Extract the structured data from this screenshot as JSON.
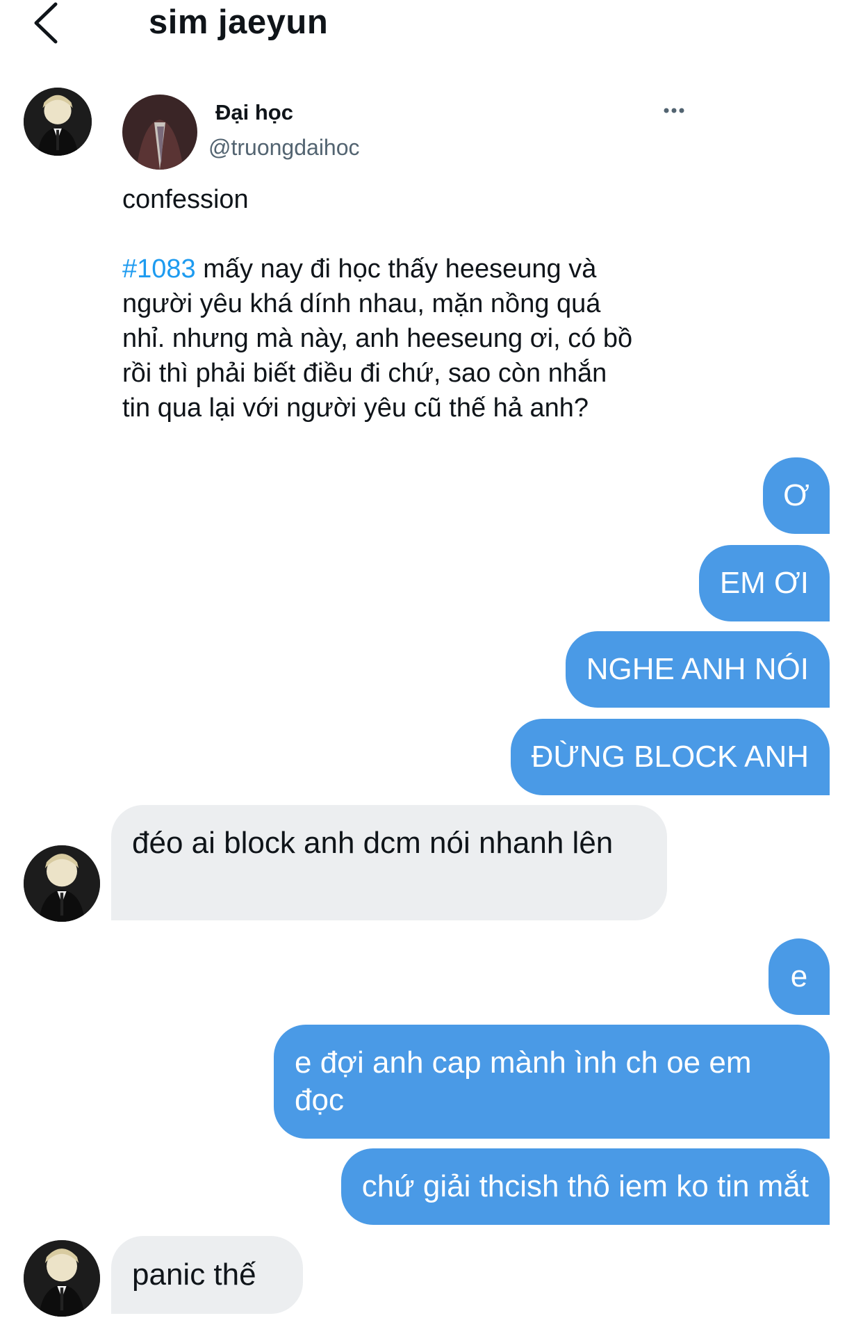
{
  "header": {
    "title": "sim jaeyun",
    "back_icon": "chevron-left-icon"
  },
  "card": {
    "name": "Đại học",
    "handle": "@truongdaihoc",
    "more_icon": "more-dots-icon",
    "label": "confession",
    "hashtag": "#1083",
    "lines": [
      " mấy nay đi học thấy heeseung và",
      "người yêu khá dính nhau, mặn nồng quá",
      "nhỉ. nhưng mà này, anh heeseung ơi, có bồ",
      "rồi thì phải biết điều đi chứ, sao còn nhắn",
      "tin qua lại với người yêu cũ thế hả anh?"
    ]
  },
  "messages": [
    {
      "dir": "sent",
      "text": "Ơ"
    },
    {
      "dir": "sent",
      "text": "EM ƠI"
    },
    {
      "dir": "sent",
      "text": "NGHE ANH NÓI"
    },
    {
      "dir": "sent",
      "text": "ĐỪNG BLOCK ANH"
    },
    {
      "dir": "received",
      "text": "đéo ai block anh dcm nói nhanh lên"
    },
    {
      "dir": "sent",
      "text": "e"
    },
    {
      "dir": "sent",
      "text": "e đợi anh cap mành ình ch oe em đọc"
    },
    {
      "dir": "sent",
      "text": "chứ giải thcish thô iem ko tin mắt"
    },
    {
      "dir": "received",
      "text": "panic thế"
    }
  ],
  "colors": {
    "sent_bubble": "#4a9ae6",
    "received_bubble": "#eceef0",
    "hashtag": "#1d9bf0",
    "handle": "#536471"
  }
}
